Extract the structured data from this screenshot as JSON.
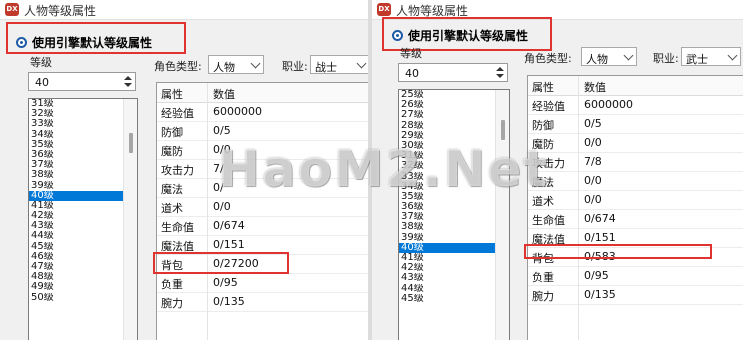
{
  "left": {
    "title": "人物等级属性",
    "app_icon": "DX",
    "use_engine_default": "使用引擎默认等级属性",
    "level_label": "等级",
    "level_value": "40",
    "level_list": [
      "31级",
      "32级",
      "33级",
      "34级",
      "35级",
      "36级",
      "37级",
      "38级",
      "39级",
      "40级",
      "41级",
      "42级",
      "43级",
      "44级",
      "45级",
      "46级",
      "47级",
      "48级",
      "49级",
      "50级"
    ],
    "selected_level": "40级",
    "role_type_label": "角色类型:",
    "role_type_value": "人物",
    "job_label": "职业:",
    "job_value": "战士",
    "headers": {
      "attr": "属性",
      "value": "数值"
    },
    "rows": [
      {
        "attr": "经验值",
        "value": "6000000"
      },
      {
        "attr": "防御",
        "value": "0/5"
      },
      {
        "attr": "魔防",
        "value": "0/0"
      },
      {
        "attr": "攻击力",
        "value": "7/"
      },
      {
        "attr": "魔法",
        "value": "0/"
      },
      {
        "attr": "道术",
        "value": "0/0"
      },
      {
        "attr": "生命值",
        "value": "0/674"
      },
      {
        "attr": "魔法值",
        "value": "0/151"
      },
      {
        "attr": "背包",
        "value": "0/27200"
      },
      {
        "attr": "负重",
        "value": "0/95"
      },
      {
        "attr": "腕力",
        "value": "0/135"
      }
    ]
  },
  "right": {
    "title": "人物等级属性",
    "app_icon": "DX",
    "use_engine_default": "使用引擎默认等级属性",
    "level_label": "等级",
    "level_value": "40",
    "level_list": [
      "25级",
      "26级",
      "27级",
      "28级",
      "29级",
      "30级",
      "31级",
      "32级",
      "33级",
      "34级",
      "35级",
      "36级",
      "37级",
      "38级",
      "39级",
      "40级",
      "41级",
      "42级",
      "43级",
      "44级",
      "45级"
    ],
    "selected_level": "40级",
    "role_type_label": "角色类型:",
    "role_type_value": "人物",
    "job_label": "职业:",
    "job_value": "武士",
    "headers": {
      "attr": "属性",
      "value": "数值"
    },
    "rows": [
      {
        "attr": "经验值",
        "value": "6000000"
      },
      {
        "attr": "防御",
        "value": "0/5"
      },
      {
        "attr": "魔防",
        "value": "0/0"
      },
      {
        "attr": "攻击力",
        "value": "7/8"
      },
      {
        "attr": "魔法",
        "value": "0/0"
      },
      {
        "attr": "道术",
        "value": "0/0"
      },
      {
        "attr": "生命值",
        "value": "0/674"
      },
      {
        "attr": "魔法值",
        "value": "0/151"
      },
      {
        "attr": "背包",
        "value": "0/583"
      },
      {
        "attr": "负重",
        "value": "0/95"
      },
      {
        "attr": "腕力",
        "value": "0/135"
      }
    ]
  },
  "watermark": "HaoM2.Net",
  "colors": {
    "highlight_box": "#e0332f",
    "selection": "#0078d7",
    "radio": "#1e5aa8"
  }
}
